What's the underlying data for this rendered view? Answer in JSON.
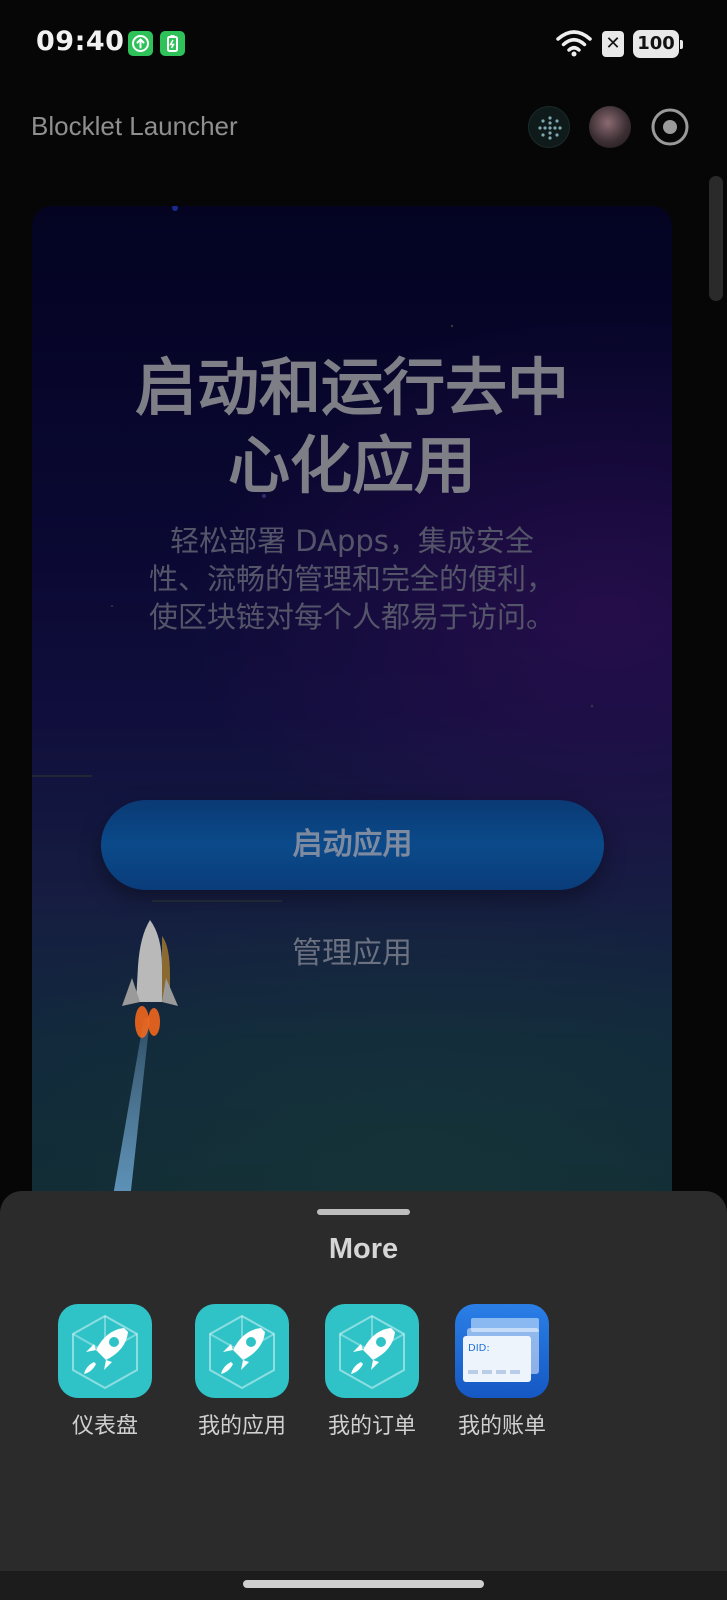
{
  "status_bar": {
    "time": "09:40",
    "battery": "100",
    "icons": [
      "upload-notification-icon",
      "battery-charging-notification-icon",
      "wifi-icon",
      "no-sim-icon",
      "battery-icon"
    ]
  },
  "header": {
    "title": "Blocklet Launcher",
    "icons": [
      "dots-grid-icon",
      "avatar",
      "record-icon"
    ]
  },
  "hero": {
    "title_line1": "启动和运行去中",
    "title_line2": "心化应用",
    "subtitle_line1": "轻松部署 DApps，集成安全",
    "subtitle_line2": "性、流畅的管理和完全的便利，",
    "subtitle_line3": "使区块链对每个人都易于访问。",
    "launch_button": "启动应用",
    "manage_link": "管理应用"
  },
  "sheet": {
    "title": "More",
    "items": [
      {
        "label": "仪表盘",
        "icon": "rocket-app-icon"
      },
      {
        "label": "我的应用",
        "icon": "rocket-app-icon"
      },
      {
        "label": "我的订单",
        "icon": "rocket-app-icon"
      },
      {
        "label": "我的账单",
        "icon": "did-wallet-icon"
      }
    ]
  },
  "colors": {
    "sheet_bg": "#2b2b2b",
    "app_icon_teal": "#2fc3c8",
    "wallet_blue": "#1e6fd9",
    "launch_button": "#0b4a8a"
  }
}
